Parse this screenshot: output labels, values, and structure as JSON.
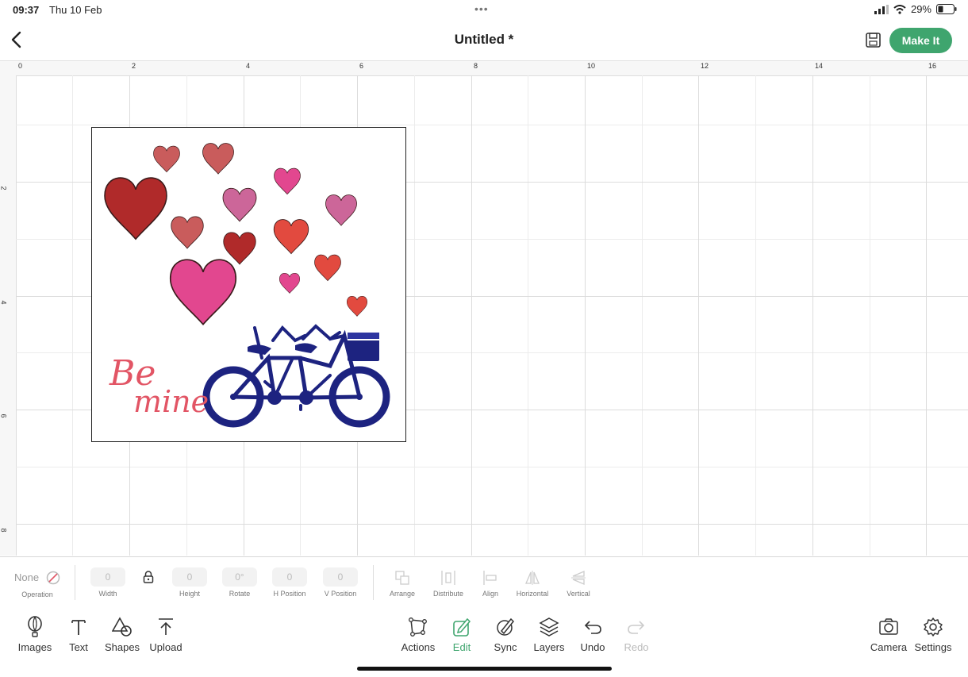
{
  "status_bar": {
    "time": "09:37",
    "date": "Thu 10 Feb",
    "battery": "29%"
  },
  "header": {
    "title": "Untitled *",
    "make_it_label": "Make It"
  },
  "ruler": {
    "top_labels": [
      "0",
      "2",
      "4",
      "6",
      "8",
      "10",
      "12",
      "14",
      "16"
    ],
    "left_labels": [
      "2",
      "4",
      "6",
      "8"
    ]
  },
  "canvas": {
    "text_be": "Be",
    "text_mine": "mine",
    "colors": {
      "heart_dark_red": "#b02a2a",
      "heart_rose": "#c95c5c",
      "heart_pink": "#e2478f",
      "heart_mauve": "#cc6699",
      "heart_red": "#e24a3f",
      "bicycle": "#1d2380",
      "text": "#e25565"
    }
  },
  "edit_toolbar": {
    "operation_value": "None",
    "operation_label": "Operation",
    "width": {
      "value": "0",
      "label": "Width"
    },
    "height": {
      "value": "0",
      "label": "Height"
    },
    "rotate": {
      "value": "0°",
      "label": "Rotate"
    },
    "h_position": {
      "value": "0",
      "label": "H Position"
    },
    "v_position": {
      "value": "0",
      "label": "V Position"
    },
    "arrange_label": "Arrange",
    "distribute_label": "Distribute",
    "align_label": "Align",
    "horizontal_label": "Horizontal",
    "vertical_label": "Vertical"
  },
  "bottom_bar": {
    "images": "Images",
    "text": "Text",
    "shapes": "Shapes",
    "upload": "Upload",
    "actions": "Actions",
    "edit": "Edit",
    "sync": "Sync",
    "layers": "Layers",
    "undo": "Undo",
    "redo": "Redo",
    "camera": "Camera",
    "settings": "Settings",
    "active_color": "#3fa56e"
  }
}
